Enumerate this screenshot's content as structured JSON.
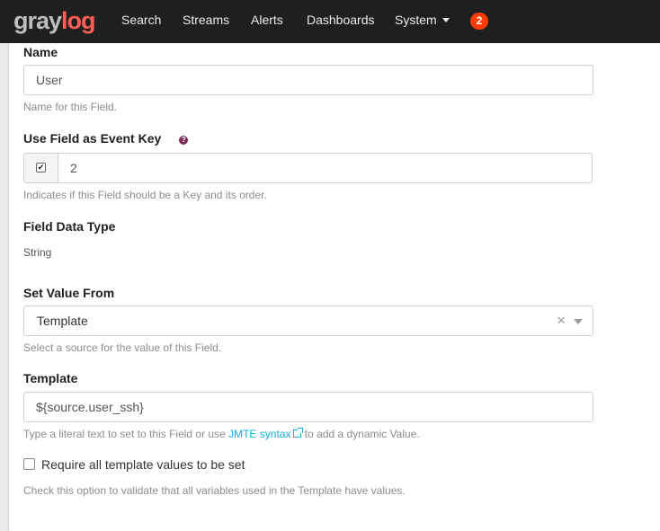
{
  "navbar": {
    "logo_left": "gray",
    "logo_right": "log",
    "items": [
      "Search",
      "Streams",
      "Alerts",
      "Dashboards",
      "System"
    ],
    "notification_count": "2"
  },
  "form": {
    "name": {
      "label": "Name",
      "value": "User",
      "help": "Name for this Field."
    },
    "event_key": {
      "label": "Use Field as Event Key",
      "help_icon": "question-circle-icon",
      "checked": true,
      "order": "2",
      "help": "Indicates if this Field should be a Key and its order."
    },
    "data_type": {
      "label": "Field Data Type",
      "value": "String"
    },
    "value_from": {
      "label": "Set Value From",
      "selected": "Template",
      "clear_glyph": "×",
      "help": "Select a source for the value of this Field."
    },
    "template": {
      "label": "Template",
      "value": "${source.user_ssh}",
      "help_before": "Type a literal text to set to this Field or use ",
      "help_link": "JMTE syntax",
      "help_after": " to add a dynamic Value."
    },
    "require_all": {
      "label": "Require all template values to be set",
      "checked": false,
      "help": "Check this option to validate that all variables used in the Template have values."
    }
  },
  "colors": {
    "navbar_bg": "#1f1f1f",
    "brand": "#fe5f55",
    "badge": "#ff3b00",
    "link": "#16ace3",
    "help_icon": "#7a2b57"
  }
}
